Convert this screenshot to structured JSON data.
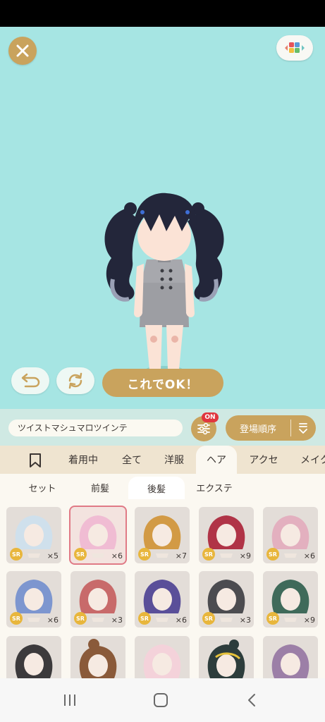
{
  "header": {
    "close_icon": "close-icon",
    "menu_icon": "color-blocks-icon"
  },
  "controls": {
    "undo_icon": "undo-icon",
    "sync_icon": "refresh-icon",
    "ok_label": "これでOK！"
  },
  "item_bar": {
    "name": "ツイストマシュマロツインテ",
    "filter_badge": "ON",
    "sort_label": "登場順序"
  },
  "tabs": [
    {
      "label": "着用中"
    },
    {
      "label": "全て"
    },
    {
      "label": "洋服"
    },
    {
      "label": "ヘア"
    },
    {
      "label": "アクセ"
    },
    {
      "label": "メイク"
    }
  ],
  "active_tab": "ヘア",
  "subtabs": [
    {
      "label": "セット"
    },
    {
      "label": "前髪"
    },
    {
      "label": "後髪"
    },
    {
      "label": "エクステ"
    }
  ],
  "active_subtab": "後髪",
  "items": [
    {
      "rarity": "SR",
      "count": "×5",
      "hair": "#cfe0ec"
    },
    {
      "rarity": "SR",
      "count": "×6",
      "hair": "#f0bcd3"
    },
    {
      "rarity": "SR",
      "count": "×7",
      "hair": "#d29a45"
    },
    {
      "rarity": "SR",
      "count": "×9",
      "hair": "#b03447"
    },
    {
      "rarity": "SR",
      "count": "×6",
      "hair": "#e3b0bf"
    },
    {
      "rarity": "SR",
      "count": "×6",
      "hair": "#7d96cf"
    },
    {
      "rarity": "SR",
      "count": "×3",
      "hair": "#c86a6a"
    },
    {
      "rarity": "SR",
      "count": "×6",
      "hair": "#5a4f99"
    },
    {
      "rarity": "SR",
      "count": "×3",
      "hair": "#4c4c50"
    },
    {
      "rarity": "SR",
      "count": "×9",
      "hair": "#3f6a5a"
    },
    {
      "rarity": "",
      "count": "",
      "hair": "#3c3a3c"
    },
    {
      "rarity": "",
      "count": "",
      "hair": "#8a5a3a"
    },
    {
      "rarity": "",
      "count": "",
      "hair": "#f4d2da"
    },
    {
      "rarity": "",
      "count": "",
      "hair": "#2d3d3c"
    },
    {
      "rarity": "",
      "count": "",
      "hair": "#9c7fa7"
    }
  ],
  "colors": {
    "stage_bg": "#a6e5e3",
    "accent_gold": "#c9a35d",
    "badge_red": "#e0363e",
    "sr_yellow": "#e8b63c",
    "selection_pink": "#e07a86"
  }
}
